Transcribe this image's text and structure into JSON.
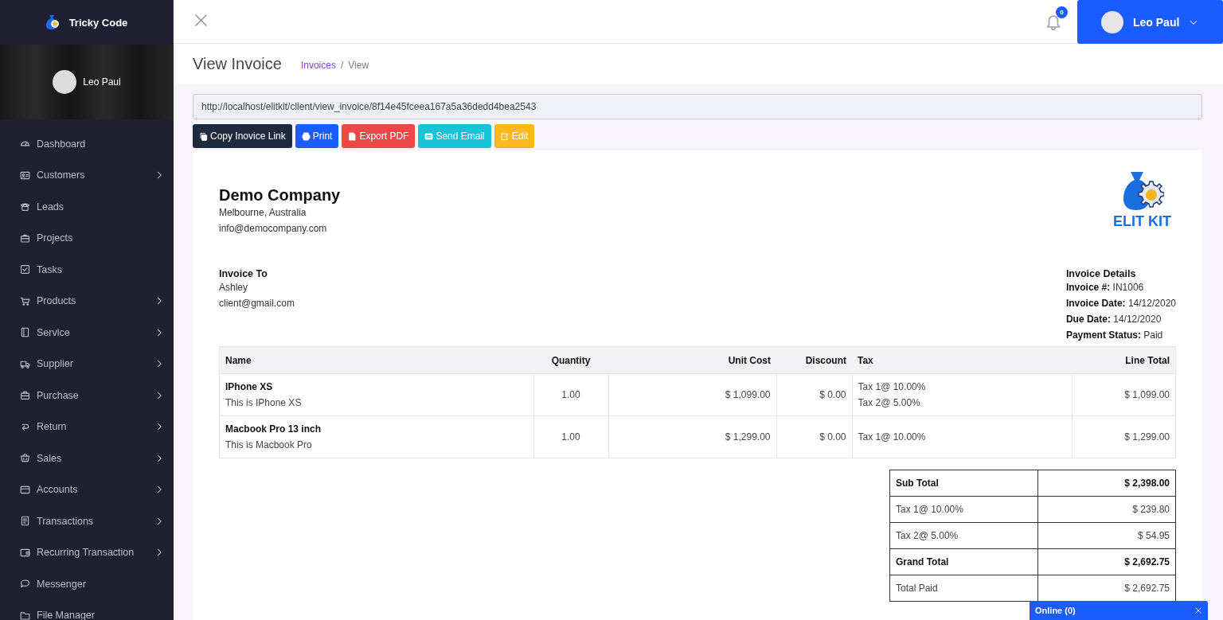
{
  "sidebar": {
    "brand": "Tricky Code",
    "profile": {
      "name": "Leo Paul"
    },
    "menu": [
      {
        "label": "Dashboard",
        "has_submenu": false
      },
      {
        "label": "Customers",
        "has_submenu": true
      },
      {
        "label": "Leads",
        "has_submenu": false
      },
      {
        "label": "Projects",
        "has_submenu": false
      },
      {
        "label": "Tasks",
        "has_submenu": false
      },
      {
        "label": "Products",
        "has_submenu": true
      },
      {
        "label": "Service",
        "has_submenu": true
      },
      {
        "label": "Supplier",
        "has_submenu": true
      },
      {
        "label": "Purchase",
        "has_submenu": true
      },
      {
        "label": "Return",
        "has_submenu": true
      },
      {
        "label": "Sales",
        "has_submenu": true
      },
      {
        "label": "Accounts",
        "has_submenu": true
      },
      {
        "label": "Transactions",
        "has_submenu": true
      },
      {
        "label": "Recurring Transaction",
        "has_submenu": true
      },
      {
        "label": "Messenger",
        "has_submenu": false
      },
      {
        "label": "File Manager",
        "has_submenu": false
      }
    ]
  },
  "topbar": {
    "notification_count": "0",
    "user": "Leo Paul"
  },
  "page": {
    "title": "View Invoice",
    "breadcrumb": [
      {
        "label": "Invoices",
        "link": true
      },
      {
        "label": "View",
        "link": false
      }
    ],
    "breadcrumb_separator": "/"
  },
  "invoice_link": {
    "value": "http://localhost/elitkit/client/view_invoice/8f14e45fceea167a5a36dedd4bea2543"
  },
  "actions": [
    {
      "label": "Copy Inovice Link",
      "kind": "copy",
      "color": "#1e2a3e"
    },
    {
      "label": "Print",
      "kind": "print",
      "color": "#1a5cff"
    },
    {
      "label": "Export PDF",
      "kind": "pdf",
      "color": "#ef4747"
    },
    {
      "label": "Send Email",
      "kind": "email",
      "color": "#16c3d8"
    },
    {
      "label": "Edit",
      "kind": "edit",
      "color": "#fdb81e"
    }
  ],
  "invoice": {
    "company": {
      "name": "Demo Company",
      "address": "Melbourne, Australia",
      "email": "info@democompany.com"
    },
    "logo_text": "ELIT KIT",
    "bill_to": {
      "heading": "Invoice To",
      "name": "Ashley",
      "email": "client@gmail.com"
    },
    "details": {
      "heading": "Invoice Details",
      "fields": [
        {
          "label": "Invoice #:",
          "value": "IN1006"
        },
        {
          "label": "Invoice Date:",
          "value": "14/12/2020"
        },
        {
          "label": "Due Date:",
          "value": "14/12/2020"
        },
        {
          "label": "Payment Status:",
          "value": "Paid"
        }
      ]
    },
    "items_table": {
      "columns": [
        "Name",
        "Quantity",
        "Unit Cost",
        "Discount",
        "Tax",
        "Line Total"
      ],
      "rows": [
        {
          "name": "IPhone XS",
          "description": "This is IPhone XS",
          "quantity": "1.00",
          "unit_cost": "$ 1,099.00",
          "discount": "$ 0.00",
          "taxes": [
            "Tax 1@ 10.00%",
            "Tax 2@ 5.00%"
          ],
          "line_total": "$ 1,099.00"
        },
        {
          "name": "Macbook Pro 13 inch",
          "description": "This is Macbook Pro",
          "quantity": "1.00",
          "unit_cost": "$ 1,299.00",
          "discount": "$ 0.00",
          "taxes": [
            "Tax 1@ 10.00%"
          ],
          "line_total": "$ 1,299.00"
        }
      ]
    },
    "totals": [
      {
        "label": "Sub Total",
        "value": "$ 2,398.00",
        "bold": true
      },
      {
        "label": "Tax 1@ 10.00%",
        "value": "$ 239.80",
        "bold": false
      },
      {
        "label": "Tax 2@ 5.00%",
        "value": "$ 54.95",
        "bold": false
      },
      {
        "label": "Grand Total",
        "value": "$ 2,692.75",
        "bold": true
      },
      {
        "label": "Total Paid",
        "value": "$ 2,692.75",
        "bold": false
      }
    ]
  },
  "chat": {
    "title": "Online (0)"
  }
}
